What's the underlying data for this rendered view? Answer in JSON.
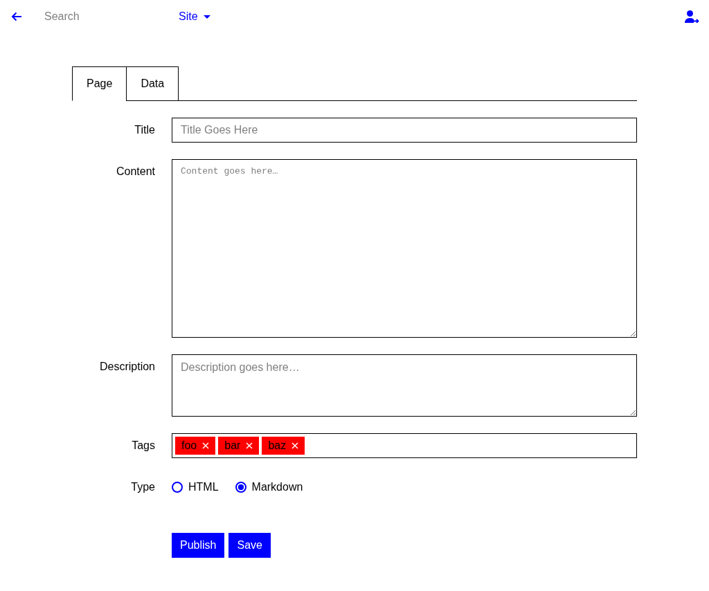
{
  "top_bar": {
    "search": {
      "placeholder": "Search"
    },
    "site_menu": {
      "label": "Site"
    }
  },
  "tabs": [
    {
      "label": "Page",
      "selected": true
    },
    {
      "label": "Data",
      "selected": false
    }
  ],
  "form": {
    "fields": [
      {
        "kind": "text",
        "label": "Title",
        "placeholder": "Title Goes Here"
      },
      {
        "kind": "code",
        "label": "Content",
        "placeholder": "Content goes here…"
      },
      {
        "kind": "textarea",
        "label": "Description",
        "placeholder": "Description goes here…"
      },
      {
        "kind": "tags",
        "label": "Tags",
        "tags": [
          "foo",
          "bar",
          "baz"
        ]
      },
      {
        "kind": "radio",
        "label": "Type",
        "options": [
          {
            "label": "HTML",
            "selected": false
          },
          {
            "label": "Markdown",
            "selected": true
          }
        ]
      }
    ],
    "buttons": [
      {
        "label": "Publish"
      },
      {
        "label": "Save"
      }
    ]
  }
}
